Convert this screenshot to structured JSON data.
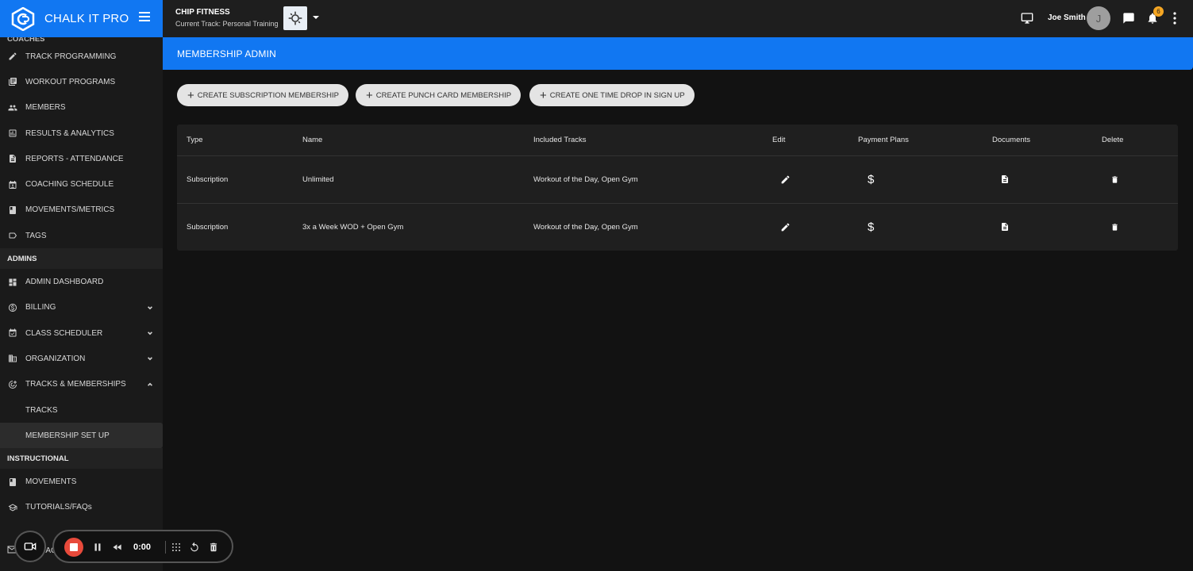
{
  "brand": {
    "name": "CHALK IT PRO"
  },
  "topbar": {
    "gym_name": "CHIP FITNESS",
    "current_track": "Current Track: Personal Training",
    "user_name": "Joe Smith",
    "avatar_initial": "J",
    "notification_count": "6"
  },
  "sidebar": {
    "coaches_label": "COACHES",
    "coaches_items": [
      {
        "label": "TRACK PROGRAMMING",
        "icon": "pencil-icon"
      },
      {
        "label": "WORKOUT PROGRAMS",
        "icon": "library-icon"
      },
      {
        "label": "MEMBERS",
        "icon": "people-icon"
      },
      {
        "label": "RESULTS & ANALYTICS",
        "icon": "analytics-icon"
      },
      {
        "label": "REPORTS - ATTENDANCE",
        "icon": "report-icon"
      },
      {
        "label": "COACHING SCHEDULE",
        "icon": "schedule-icon"
      },
      {
        "label": "MOVEMENTS/METRICS",
        "icon": "book-icon"
      },
      {
        "label": "TAGS",
        "icon": "tag-icon"
      }
    ],
    "admins_label": "ADMINS",
    "admins_items": [
      {
        "label": "ADMIN DASHBOARD",
        "icon": "dashboard-icon"
      },
      {
        "label": "BILLING",
        "icon": "dollar-icon"
      },
      {
        "label": "CLASS SCHEDULER",
        "icon": "calendar-icon"
      },
      {
        "label": "ORGANIZATION",
        "icon": "building-icon"
      },
      {
        "label": "TRACKS & MEMBERSHIPS",
        "icon": "tracks-icon"
      }
    ],
    "sub_items": [
      {
        "label": "TRACKS"
      },
      {
        "label": "MEMBERSHIP SET UP"
      }
    ],
    "instructional_label": "INSTRUCTIONAL",
    "instructional_items": [
      {
        "label": "MOVEMENTS",
        "icon": "book-icon"
      },
      {
        "label": "TUTORIALS/FAQs",
        "icon": "school-icon"
      }
    ],
    "partial_item": "TAG"
  },
  "page": {
    "title": "MEMBERSHIP ADMIN"
  },
  "actions": {
    "create_subscription": "CREATE SUBSCRIPTION MEMBERSHIP",
    "create_punch_card": "CREATE PUNCH CARD MEMBERSHIP",
    "create_drop_in": "CREATE ONE TIME DROP IN SIGN UP"
  },
  "table": {
    "headers": {
      "type": "Type",
      "name": "Name",
      "tracks": "Included Tracks",
      "edit": "Edit",
      "payment": "Payment Plans",
      "documents": "Documents",
      "delete": "Delete"
    },
    "rows": [
      {
        "type": "Subscription",
        "name": "Unlimited",
        "tracks": "Workout of the Day, Open Gym",
        "payment_symbol": "$"
      },
      {
        "type": "Subscription",
        "name": "3x a Week WOD + Open Gym",
        "tracks": "Workout of the Day, Open Gym",
        "payment_symbol": "$"
      }
    ]
  },
  "recorder": {
    "time": "0:00"
  },
  "colors": {
    "accent": "#1177f2",
    "record": "#e84a3b",
    "badge": "#f5a623"
  }
}
